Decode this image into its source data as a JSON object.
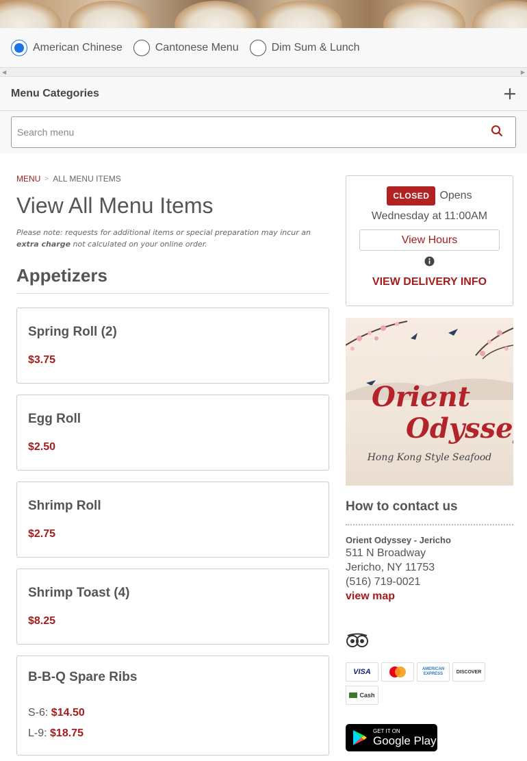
{
  "menus": [
    {
      "label": "American Chinese",
      "selected": true
    },
    {
      "label": "Cantonese Menu",
      "selected": false
    },
    {
      "label": "Dim Sum & Lunch",
      "selected": false
    }
  ],
  "categories": {
    "title": "Menu Categories"
  },
  "search": {
    "placeholder": "Search menu"
  },
  "breadcrumb": {
    "home": "MENU",
    "current": "ALL MENU ITEMS"
  },
  "page": {
    "title": "View All Menu Items",
    "note_prefix": "Please note: requests for additional items or special preparation may incur an ",
    "note_bold": "extra charge",
    "note_suffix": " not calculated on your online order."
  },
  "section": {
    "title": "Appetizers"
  },
  "items": [
    {
      "name": "Spring Roll (2)",
      "price": "$3.75"
    },
    {
      "name": "Egg Roll",
      "price": "$2.50"
    },
    {
      "name": "Shrimp Roll",
      "price": "$2.75"
    },
    {
      "name": "Shrimp Toast (4)",
      "price": "$8.25"
    },
    {
      "name": "B-B-Q Spare Ribs",
      "sizes": [
        {
          "label": "S-6:",
          "price": "$14.50"
        },
        {
          "label": "L-9:",
          "price": "$18.75"
        }
      ]
    }
  ],
  "status": {
    "badge": "CLOSED",
    "opens": "Opens",
    "time": "Wednesday at 11:00AM",
    "hours_button": "View Hours",
    "delivery": "VIEW DELIVERY INFO"
  },
  "logo": {
    "line1": "Orient",
    "line2": "Odyssey",
    "tagline": "Hong Kong Style Seafood"
  },
  "contact": {
    "title": "How to contact us",
    "name": "Orient Odyssey - Jericho",
    "address1": "511 N Broadway",
    "address2": "Jericho, NY 11753",
    "phone": "(516) 719-0021",
    "map": "view map"
  },
  "payments": [
    {
      "label": "VISA",
      "color": "#1a1f71"
    },
    {
      "label": "MC",
      "color": "#eb001b"
    },
    {
      "label": "AMERICAN EXPRESS",
      "color": "#2e77bc"
    },
    {
      "label": "DISCOVER",
      "color": "#e55c20"
    },
    {
      "label": "Cash",
      "color": "#3a7a2a"
    }
  ],
  "app": {
    "small": "GET IT ON",
    "big": "Google Play"
  },
  "colors": {
    "accent": "#a51c1c",
    "radio": "#1a73e8"
  }
}
